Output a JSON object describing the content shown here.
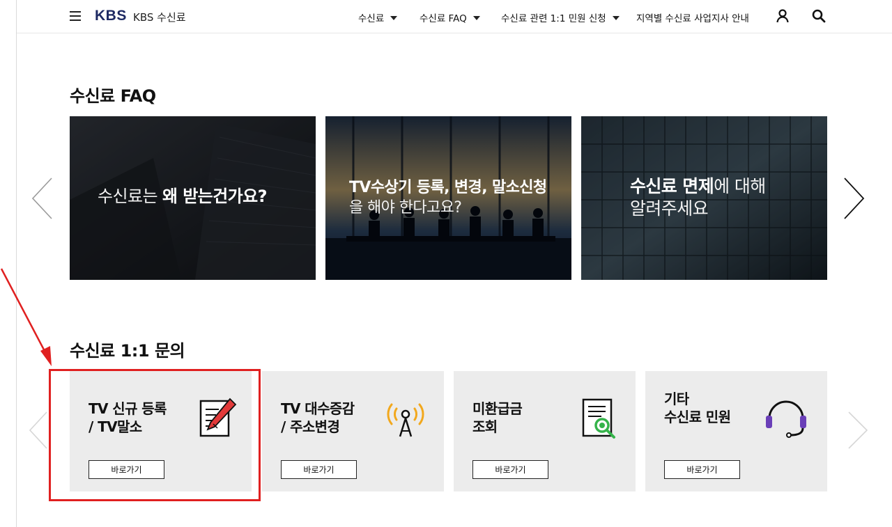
{
  "header": {
    "logo": "KBS",
    "site_title": "KBS 수신료",
    "nav": [
      {
        "label": "수신료",
        "has_dropdown": true
      },
      {
        "label": "수신료 FAQ",
        "has_dropdown": true
      },
      {
        "label": "수신료 관련 1:1 민원 신청",
        "has_dropdown": true
      },
      {
        "label": "지역별 수신료 사업지사 안내",
        "has_dropdown": false
      }
    ],
    "icons": [
      "menu-icon",
      "user-icon",
      "search-icon"
    ]
  },
  "faq": {
    "title": "수신료 FAQ",
    "cards": [
      {
        "plain_before": "수신료는 ",
        "bold": "왜 받는건가요?",
        "plain_after": ""
      },
      {
        "bold": "TV수상기 등록, 변경, 말소신청",
        "plain_after": "을 해야 한다고요?"
      },
      {
        "bold": "수신료 면제",
        "plain_after": "에 대해",
        "line2": "알려주세요"
      }
    ]
  },
  "qna": {
    "title": "수신료 1:1 문의",
    "cards": [
      {
        "line1": "TV 신규 등록",
        "line2": "/ TV말소",
        "button": "바로가기",
        "icon": "document-pencil-icon"
      },
      {
        "line1": "TV 대수증감",
        "line2": "/ 주소변경",
        "button": "바로가기",
        "icon": "antenna-icon"
      },
      {
        "line1": "미환급금",
        "line2": "조회",
        "button": "바로가기",
        "icon": "document-search-icon"
      },
      {
        "line1": "기타",
        "line2": "수신료 민원",
        "button": "바로가기",
        "icon": "headset-icon"
      }
    ]
  },
  "colors": {
    "logo": "#1e2a63",
    "card_bg": "#ececec",
    "annotation": "#e02020",
    "pencil": "#e23a3a",
    "antenna": "#f2a81d",
    "magnifier": "#35b34a",
    "headset": "#6a3fb8"
  }
}
